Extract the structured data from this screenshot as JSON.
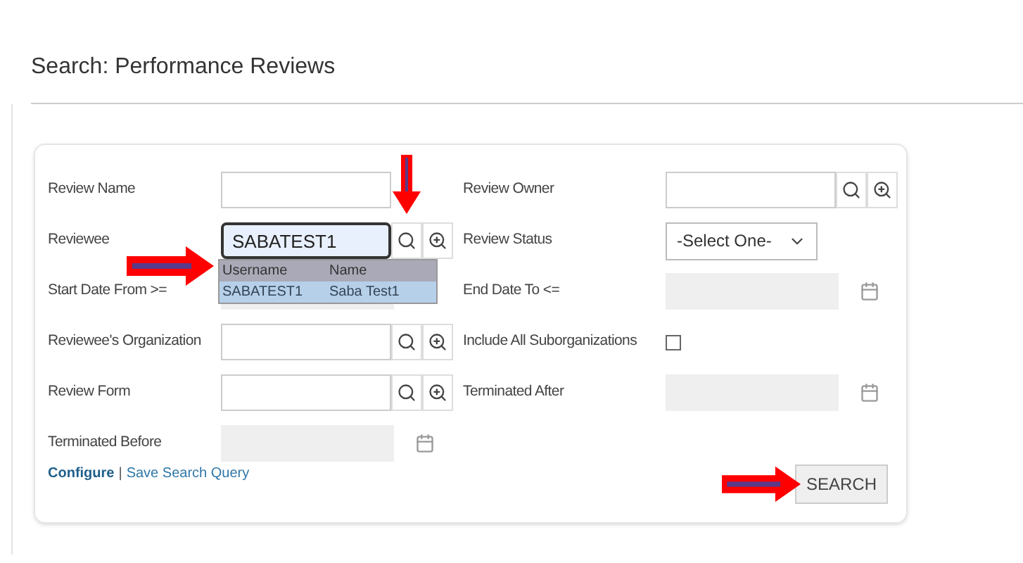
{
  "title": "Search: Performance Reviews",
  "fields": [
    {
      "label": "Review Name",
      "kind": "text"
    },
    {
      "label": "Review Owner",
      "kind": "lookup",
      "focused": false
    },
    {
      "label": "Reviewee",
      "kind": "lookup",
      "value": "SABATEST1",
      "focused": true,
      "autocomplete": {
        "columns": [
          "Username",
          "Name"
        ],
        "rows": [
          {
            "cells": [
              "SABATEST1",
              "Saba Test1"
            ],
            "selected": true
          }
        ]
      }
    },
    {
      "label": "Review Status",
      "kind": "select",
      "value": "-Select One-"
    },
    {
      "label": "Start Date From >=",
      "kind": "date"
    },
    {
      "label": "End Date To <=",
      "kind": "date"
    },
    {
      "label": "Reviewee's Organization",
      "kind": "lookup",
      "focused": false
    },
    {
      "label": "Include All Suborganizations",
      "kind": "checkbox",
      "checked": false
    },
    {
      "label": "Review Form",
      "kind": "lookup",
      "focused": false
    },
    {
      "label": "Terminated After",
      "kind": "date"
    },
    {
      "label": "Terminated Before",
      "kind": "date"
    }
  ],
  "links": [
    "Configure",
    "Save Search Query"
  ],
  "separator": "|",
  "search_button": "SEARCH"
}
